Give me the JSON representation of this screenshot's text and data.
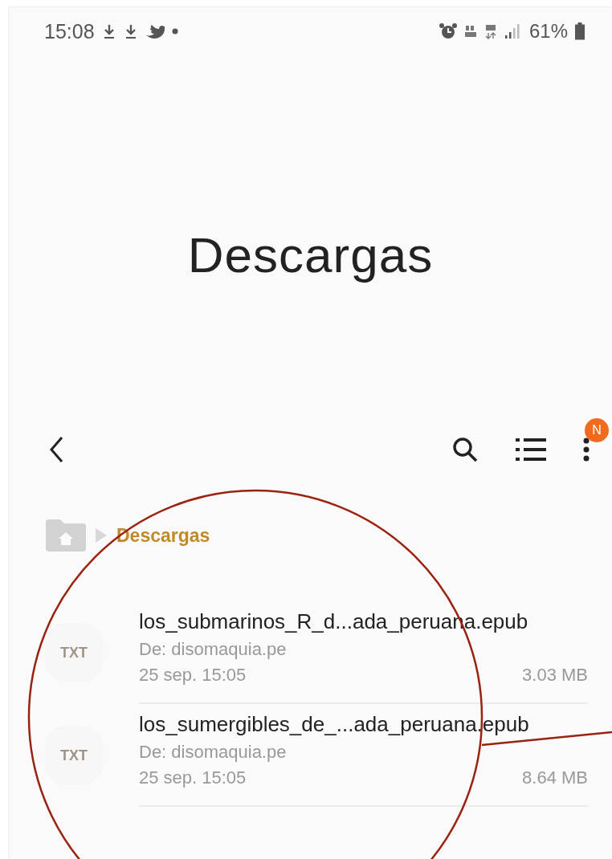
{
  "status_bar": {
    "time": "15:08",
    "battery": "61%"
  },
  "title": "Descargas",
  "toolbar": {
    "menu_badge": "N"
  },
  "breadcrumb": [
    {
      "label": "Descargas",
      "selected": true
    }
  ],
  "files": [
    {
      "type": "TXT",
      "name": "los_submarinos_R_d...ada_peruana.epub",
      "source": "De: disomaquia.pe",
      "date": "25 sep. 15:05",
      "size": "3.03 MB"
    },
    {
      "type": "TXT",
      "name": "los_sumergibles_de_...ada_peruana.epub",
      "source": "De: disomaquia.pe",
      "date": "25 sep. 15:05",
      "size": "8.64 MB"
    }
  ]
}
